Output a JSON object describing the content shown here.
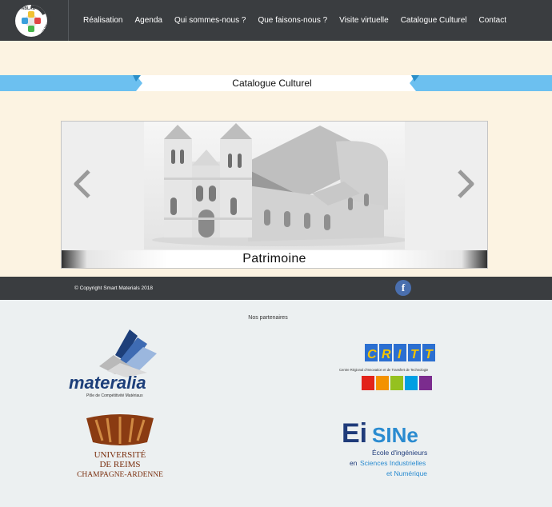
{
  "logo": {
    "top_text": "FABLAB",
    "side_text": "SMART MATERIALS",
    "icon": "fablab-logo"
  },
  "nav": {
    "items": [
      {
        "label": "Réalisation"
      },
      {
        "label": "Agenda"
      },
      {
        "label": "Qui sommes-nous ?"
      },
      {
        "label": "Que faisons-nous ?"
      },
      {
        "label": "Visite virtuelle"
      },
      {
        "label": "Catalogue Culturel"
      },
      {
        "label": "Contact"
      }
    ]
  },
  "section": {
    "title": "Catalogue Culturel"
  },
  "slider": {
    "caption": "Patrimoine",
    "image": "church-3d-model",
    "prev_icon": "chevron-left-icon",
    "next_icon": "chevron-right-icon"
  },
  "footer": {
    "copyright": "© Copyright Smart Materials 2018",
    "social_icon": "facebook-icon",
    "social_letter": "f"
  },
  "partners": {
    "title": "Nos partenaires",
    "materalia": {
      "name": "materalia",
      "subtitle": "Pôle de Compétitivité Matériaux"
    },
    "critt": {
      "letters": [
        "C",
        "R",
        "I",
        "T",
        "T"
      ],
      "subtitle": "Centre Régional d'Innovation et de Transfert de Technologie"
    },
    "urca": {
      "line1": "UNIVERSITÉ",
      "line2": "DE REIMS",
      "line3": "CHAMPAGNE-ARDENNE"
    },
    "eisine": {
      "name_part1": "Ei",
      "name_part2": "SINe",
      "line1": "École d'ingénieurs",
      "line2_prefix": "en ",
      "line2": "Sciences Industrielles",
      "line3": "et Numérique"
    }
  },
  "colors": {
    "nav_bg": "#3a3d40",
    "cream": "#fcf3e2",
    "banner_blue": "#6cc0f0",
    "bottom_bg": "#ecf0f1"
  }
}
